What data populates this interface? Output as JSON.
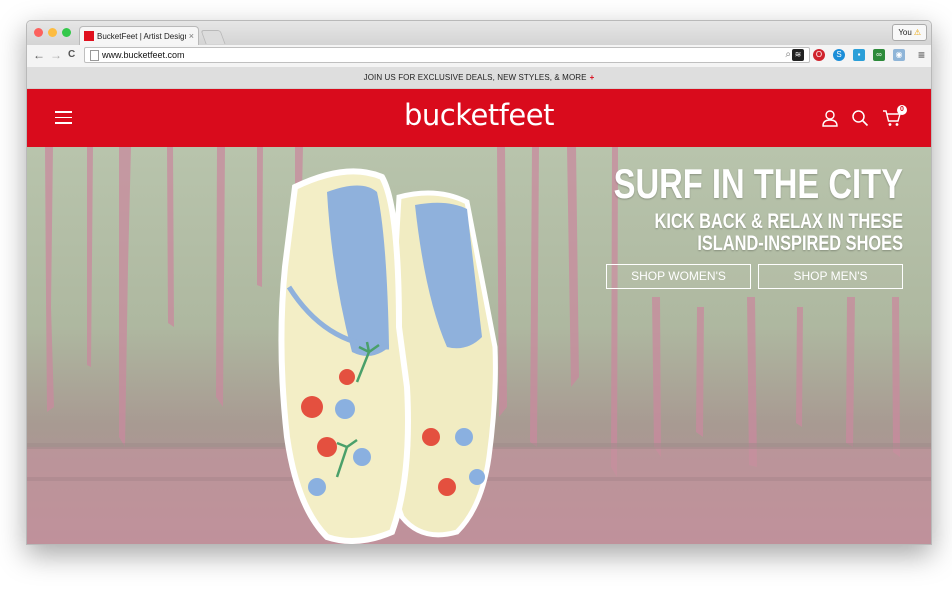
{
  "browser": {
    "tab_title": "BucketFeet | Artist Designe",
    "tab_close": "×",
    "profile_label": "You",
    "profile_warning": "⚠",
    "url": "www.bucketfeet.com",
    "back_glyph": "←",
    "forward_glyph": "→",
    "reload_glyph": "C",
    "menu_glyph": "≡",
    "colors": {
      "close": "#fc615d",
      "minimize": "#fdbc40",
      "zoom": "#34c84a"
    }
  },
  "promo": {
    "text": "JOIN US FOR EXCLUSIVE DEALS, NEW STYLES, & MORE",
    "plus": "+"
  },
  "header": {
    "logo": "bucketfeet",
    "cart_count": "0",
    "brand_color": "#d90b1c",
    "icons": [
      "menu-icon",
      "account-icon",
      "search-icon",
      "cart-icon"
    ]
  },
  "hero": {
    "headline": "SURF IN THE CITY",
    "subhead_line1": "KICK BACK & RELAX IN THESE",
    "subhead_line2": "ISLAND-INSPIRED SHOES",
    "cta_women": "SHOP WOMEN'S",
    "cta_men": "SHOP MEN'S"
  }
}
